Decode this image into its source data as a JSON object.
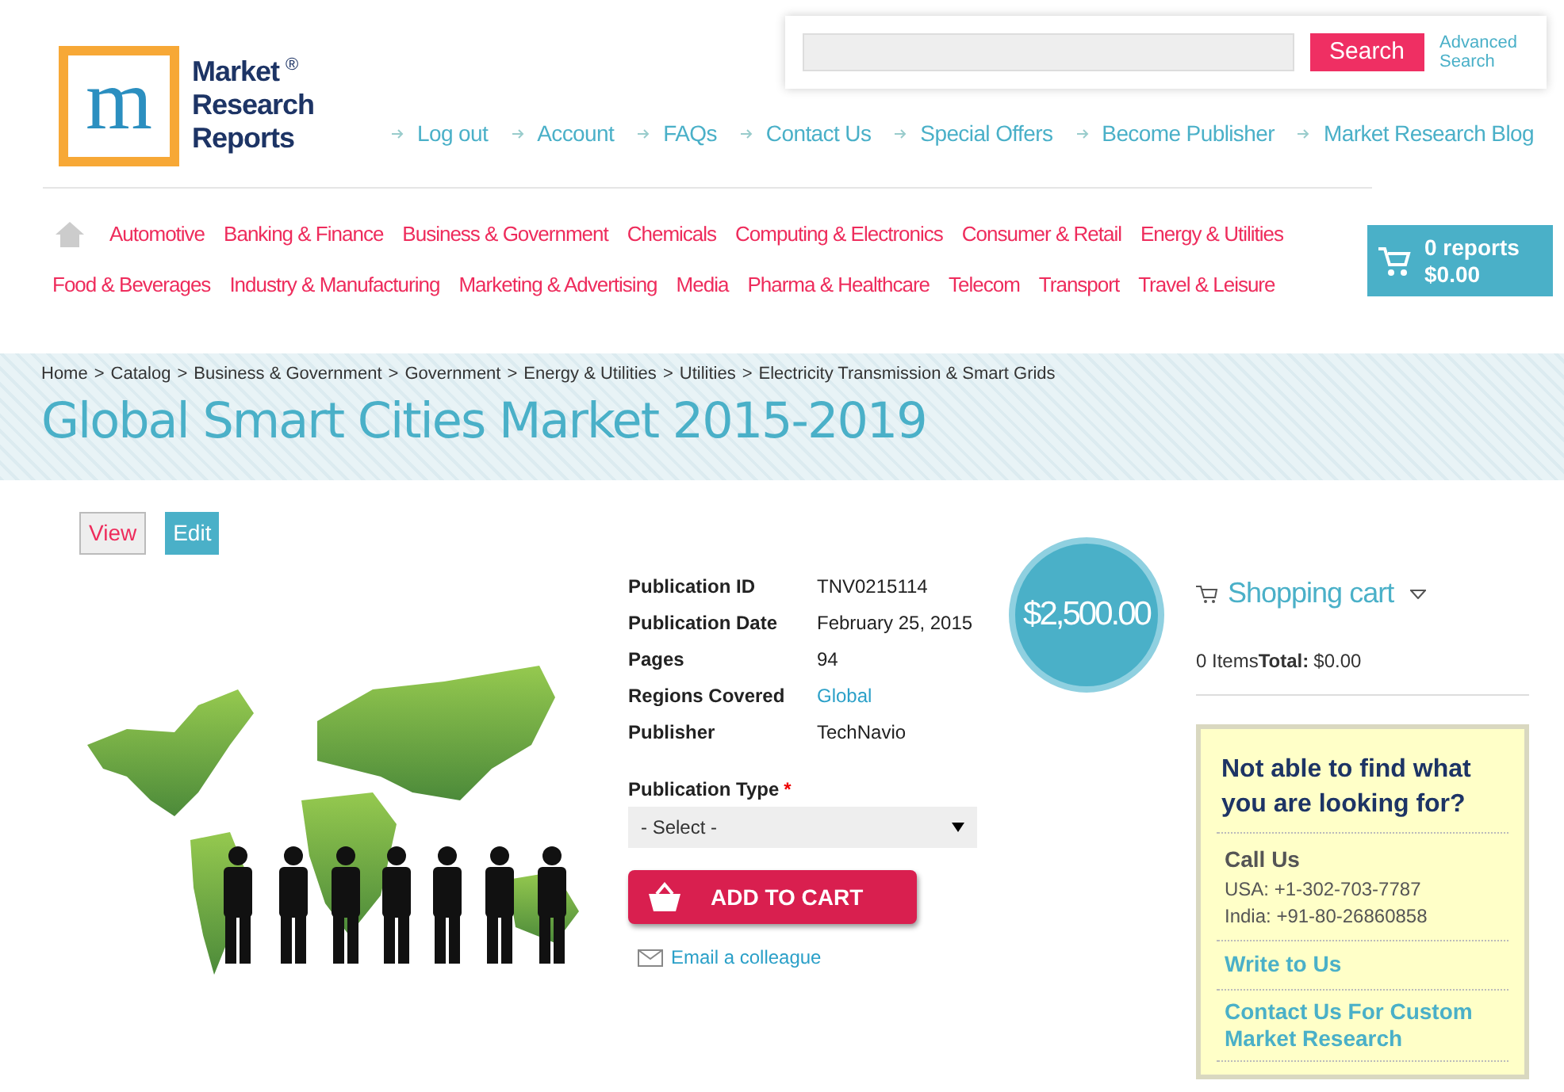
{
  "logo": {
    "line_1": "Market",
    "line_2": "Research",
    "line_3": "Reports",
    "mark": "®",
    "letter": "m"
  },
  "search": {
    "button": "Search",
    "advanced": "Advanced Search"
  },
  "top_links": [
    "Log out",
    "Account",
    "FAQs",
    "Contact Us",
    "Special Offers",
    "Become Publisher",
    "Market Research Blog"
  ],
  "category_rows": [
    [
      "Automotive",
      "Banking & Finance",
      "Business & Government",
      "Chemicals",
      "Computing & Electronics",
      "Consumer & Retail",
      "Energy & Utilities"
    ],
    [
      "Food & Beverages",
      "Industry & Manufacturing",
      "Marketing & Advertising",
      "Media",
      "Pharma & Healthcare",
      "Telecom",
      "Transport",
      "Travel & Leisure"
    ]
  ],
  "cart_button": {
    "count": "0 reports",
    "total": "$0.00"
  },
  "breadcrumb_separator": ">",
  "breadcrumb": [
    "Home",
    "Catalog",
    "Business & Government",
    "Government",
    "Energy & Utilities",
    "Utilities",
    "Electricity Transmission & Smart Grids"
  ],
  "title": "Global Smart Cities Market 2015-2019",
  "tabs": [
    {
      "label": "View",
      "selected": true
    },
    {
      "label": "Edit",
      "selected": false
    }
  ],
  "details": [
    {
      "label": "Publication ID",
      "value": "TNV0215114",
      "kind": "text"
    },
    {
      "label": "Publication Date",
      "value": "February 25, 2015",
      "kind": "text"
    },
    {
      "label": "Pages",
      "value": "94",
      "kind": "text"
    },
    {
      "label": "Regions Covered",
      "value": "Global",
      "kind": "link"
    },
    {
      "label": "Publisher",
      "value": "TechNavio",
      "kind": "text"
    }
  ],
  "price": "$2,500.00",
  "publication_type": {
    "label": "Publication Type",
    "required": "*",
    "value": "- Select -"
  },
  "add_to_cart": "ADD TO CART",
  "email_link": "Email a colleague",
  "shopping_cart": {
    "title": "Shopping cart",
    "items": "0 Items",
    "total_label": "Total:",
    "total": "$0.00"
  },
  "help_box": {
    "heading": "Not able to find what you are looking for?",
    "call_title": "Call Us",
    "phones": [
      "USA: +1-302-703-7787",
      "India: +91-80-26860858"
    ],
    "write": "Write to Us",
    "custom": "Contact Us For Custom Market Research"
  }
}
